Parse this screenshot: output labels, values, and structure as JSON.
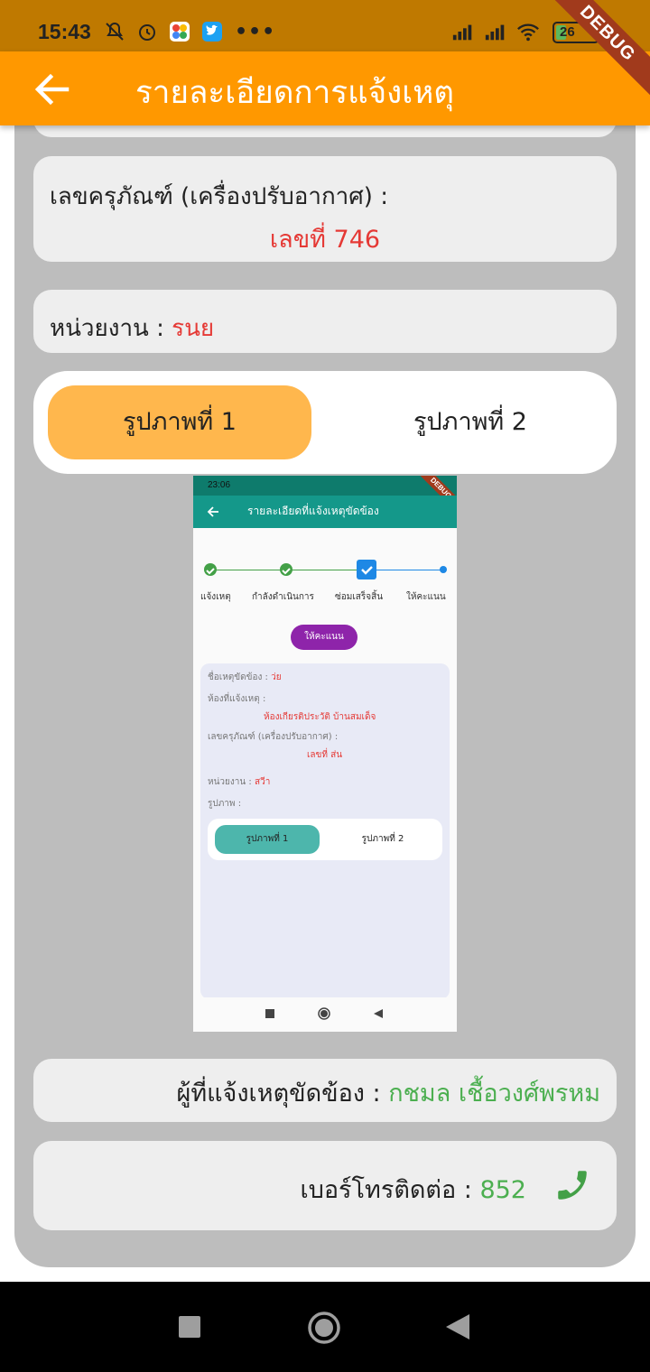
{
  "status_bar": {
    "time": "15:43",
    "more": "•••",
    "battery": "26",
    "battery_level": 0.26,
    "icons": [
      "mute-icon",
      "alarm-icon",
      "photos-icon",
      "twitter-icon",
      "signal-icon",
      "signal-icon",
      "wifi-icon",
      "battery-icon"
    ]
  },
  "debug_banner": "DEBUG",
  "app_bar": {
    "title": "รายละเอียดการแจ้งเหตุ",
    "back_icon": "arrow-left-icon"
  },
  "equipment": {
    "label": "เลขครุภัณฑ์ (เครื่องปรับอากาศ) :",
    "value": "เลขที่ 746"
  },
  "department": {
    "label": "หน่วยงาน :",
    "value": "รนย"
  },
  "image_tabs": {
    "tab1": "รูปภาพที่ 1",
    "tab2": "รูปภาพที่ 2",
    "selected": 0
  },
  "embedded_screenshot": {
    "time": "23:06",
    "debug": "DEBUG",
    "title": "รายละเอียดที่แจ้งเหตุขัดข้อง",
    "steps": [
      "แจ้งเหตุ",
      "กำลังดำเนินการ",
      "ซ่อมเสร็จสิ้น",
      "ให้คะแนน"
    ],
    "rate_button": "ให้คะแนน",
    "issue_label": "ชื่อเหตุขัดข้อง :",
    "issue_value": "ว่ย",
    "room_label": "ห้องที่แจ้งเหตุ :",
    "room_value": "ห้องเกียรติประวัติ บ้านสมเด็จ",
    "equip_label": "เลขครุภัณฑ์ (เครื่องปรับอากาศ) :",
    "equip_value": "เลขที่ ส่น",
    "dept_label": "หน่วยงาน :",
    "dept_value": "สวีา",
    "image_label": "รูปภาพ :",
    "tab1": "รูปภาพที่ 1",
    "tab2": "รูปภาพที่ 2"
  },
  "reporter": {
    "label": "ผู้ที่แจ้งเหตุขัดข้อง :",
    "value": "กชมล เชื้อวงศ์พรหม"
  },
  "phone": {
    "label": "เบอร์โทรติดต่อ :",
    "value": "852",
    "icon": "phone-icon"
  },
  "colors": {
    "status_bar": "#bf7900",
    "app_bar": "#ff9800",
    "selected_tab": "#ffb74d",
    "value_red": "#e53935",
    "value_green": "#4caf50",
    "panel_grey": "#bdbdbd"
  }
}
